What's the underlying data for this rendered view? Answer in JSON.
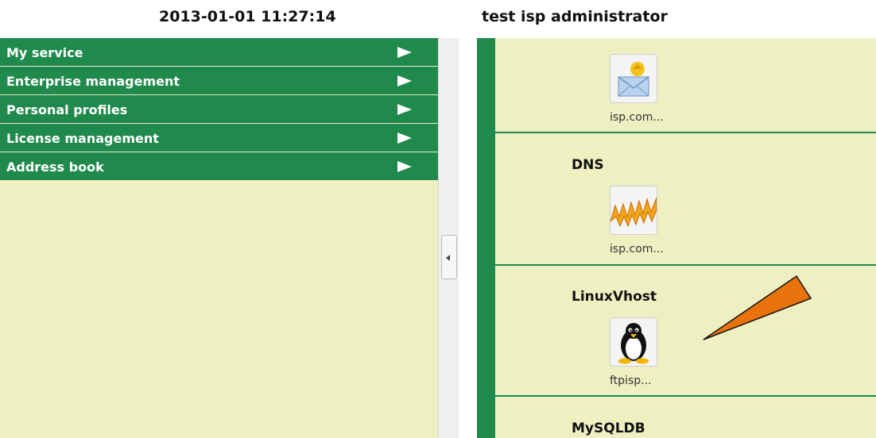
{
  "header": {
    "datetime": "2013-01-01 11:27:14",
    "user": "test isp administrator"
  },
  "sidebar": {
    "items": [
      {
        "label": "My service"
      },
      {
        "label": "Enterprise management"
      },
      {
        "label": "Personal profiles"
      },
      {
        "label": "License management"
      },
      {
        "label": "Address book"
      }
    ]
  },
  "services": [
    {
      "title": "",
      "icon": "mail-icon",
      "caption": "isp.com..."
    },
    {
      "title": "DNS",
      "icon": "www-icon",
      "caption": "isp.com..."
    },
    {
      "title": "LinuxVhost",
      "icon": "penguin-icon",
      "caption": "ftpisp..."
    },
    {
      "title": "MySQLDB",
      "icon": "",
      "caption": ""
    }
  ],
  "colors": {
    "menu_green": "#1f8a4c",
    "panel_bg": "#eef0c2",
    "annotation_orange": "#e8720c"
  }
}
